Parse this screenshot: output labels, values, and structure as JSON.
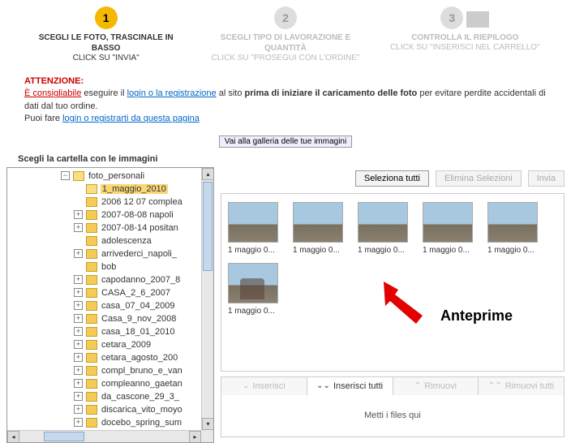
{
  "steps": [
    {
      "num": "1",
      "title": "SCEGLI LE FOTO, TRASCINALE IN BASSO",
      "sub": "CLICK SU \"INVIA\"",
      "active": true
    },
    {
      "num": "2",
      "title": "SCEGLI TIPO DI LAVORAZIONE E QUANTITÀ",
      "sub": "CLICK SU \"PROSEGUI CON L'ORDINE\"",
      "active": false
    },
    {
      "num": "3",
      "title": "CONTROLLA IL RIEPILOGO",
      "sub": "CLICK SU \"INSERISCI NEL CARRELLO\"",
      "active": false
    }
  ],
  "warning": {
    "att": "ATTENZIONE:",
    "cons": "È consigliabile",
    "t1": " eseguire il ",
    "link1": "login o la registrazione",
    "t2": " al sito ",
    "bold1": "prima di iniziare il caricamento delle foto",
    "t3": " per evitare perdite accidentali di dati dal tuo ordine.",
    "t4": "Puoi fare ",
    "link2": "login o registrarti da questa pagina"
  },
  "gallery_btn": "Vai alla galleria delle tue immagini",
  "section_label": "Scegli la cartella con le immagini",
  "tree": {
    "root": "foto_personali",
    "selected": "1_maggio_2010",
    "items": [
      {
        "label": "1_maggio_2010",
        "expandable": false,
        "selected": true
      },
      {
        "label": "2006 12 07  complea",
        "expandable": false
      },
      {
        "label": "2007-08-08 napoli",
        "expandable": true
      },
      {
        "label": "2007-08-14 positan",
        "expandable": true
      },
      {
        "label": "adolescenza",
        "expandable": false
      },
      {
        "label": "arrivederci_napoli_",
        "expandable": true
      },
      {
        "label": "bob",
        "expandable": false
      },
      {
        "label": "capodanno_2007_8",
        "expandable": true
      },
      {
        "label": "CASA_2_6_2007",
        "expandable": true
      },
      {
        "label": "casa_07_04_2009",
        "expandable": true
      },
      {
        "label": "Casa_9_nov_2008",
        "expandable": true
      },
      {
        "label": "casa_18_01_2010",
        "expandable": true
      },
      {
        "label": "cetara_2009",
        "expandable": true
      },
      {
        "label": "cetara_agosto_200",
        "expandable": true
      },
      {
        "label": "compl_bruno_e_van",
        "expandable": true
      },
      {
        "label": "compleanno_gaetan",
        "expandable": true
      },
      {
        "label": "da_cascone_29_3_",
        "expandable": true
      },
      {
        "label": "discarica_vito_moyo",
        "expandable": true
      },
      {
        "label": "docebo_spring_sum",
        "expandable": true
      }
    ]
  },
  "top_buttons": {
    "select_all": "Seleziona tutti",
    "delete_sel": "Elimina Selezioni",
    "send": "Invia"
  },
  "thumbs": [
    {
      "label": "1 maggio 0..."
    },
    {
      "label": "1 maggio 0..."
    },
    {
      "label": "1 maggio 0..."
    },
    {
      "label": "1 maggio 0..."
    },
    {
      "label": "1 maggio 0..."
    },
    {
      "label": "1 maggio 0..."
    }
  ],
  "annotation": "Anteprime",
  "action_bar": {
    "insert": "Inserisci",
    "insert_all": "Inserisci tutti",
    "remove": "Rimuovi",
    "remove_all": "Rimuovi tutti"
  },
  "drop_zone": "Metti i files qui"
}
